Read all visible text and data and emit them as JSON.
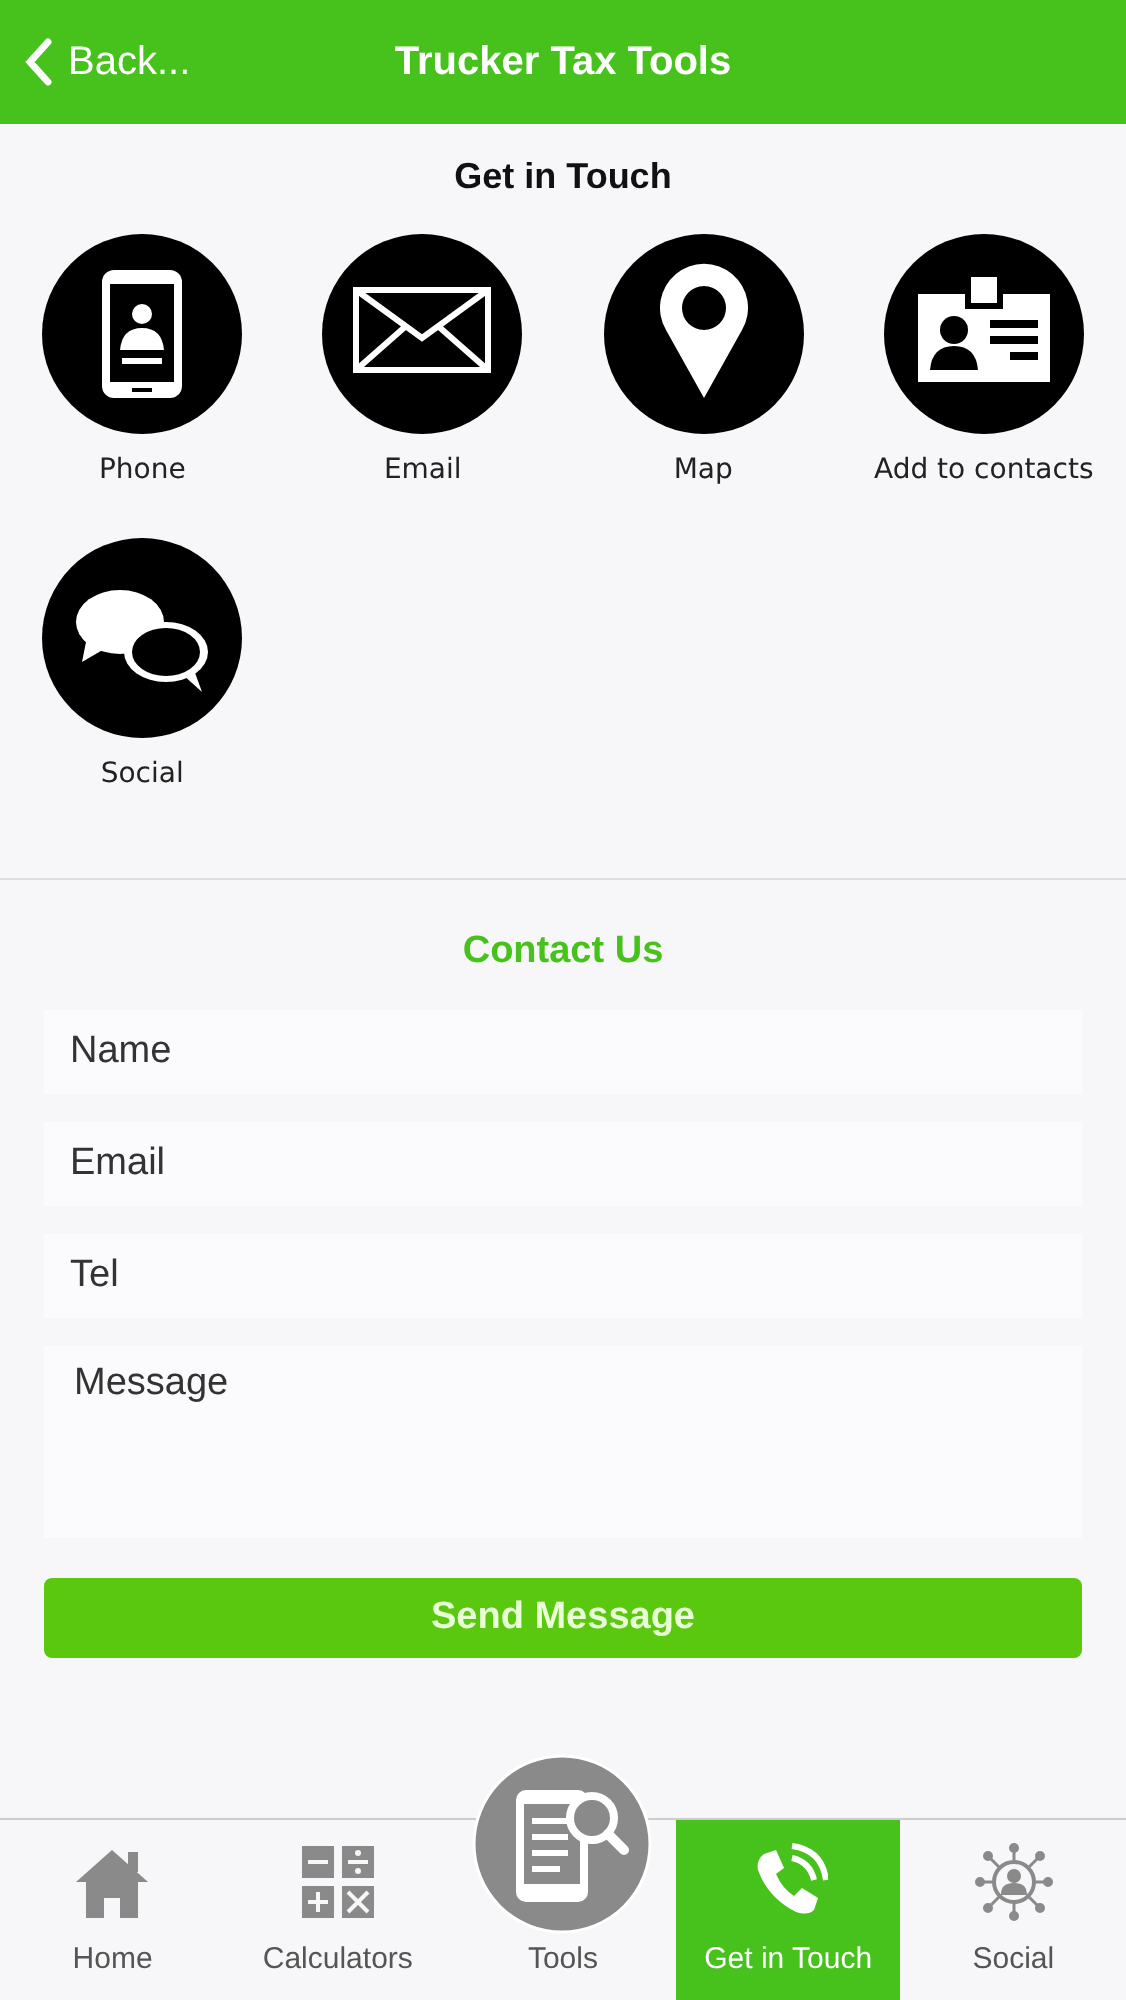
{
  "header": {
    "back": "Back...",
    "title": "Trucker Tax Tools"
  },
  "section_title": "Get in Touch",
  "actions": [
    {
      "kind": "phone",
      "label": "Phone"
    },
    {
      "kind": "email",
      "label": "Email"
    },
    {
      "kind": "map",
      "label": "Map"
    },
    {
      "kind": "contact",
      "label": "Add to contacts"
    },
    {
      "kind": "social",
      "label": "Social"
    }
  ],
  "form": {
    "title": "Contact Us",
    "fields": [
      {
        "placeholder": "Name",
        "kind": "line"
      },
      {
        "placeholder": "Email",
        "kind": "line"
      },
      {
        "placeholder": "Tel",
        "kind": "line"
      },
      {
        "placeholder": "Message",
        "kind": "area"
      }
    ],
    "submit": "Send Message"
  },
  "tabs": [
    {
      "label": "Home",
      "kind": "home",
      "selected": false
    },
    {
      "label": "Calculators",
      "kind": "calc",
      "selected": false
    },
    {
      "label": "Tools",
      "kind": "tools",
      "selected": false
    },
    {
      "label": "Get in Touch",
      "kind": "call",
      "selected": true
    },
    {
      "label": "Social",
      "kind": "network",
      "selected": false
    }
  ]
}
